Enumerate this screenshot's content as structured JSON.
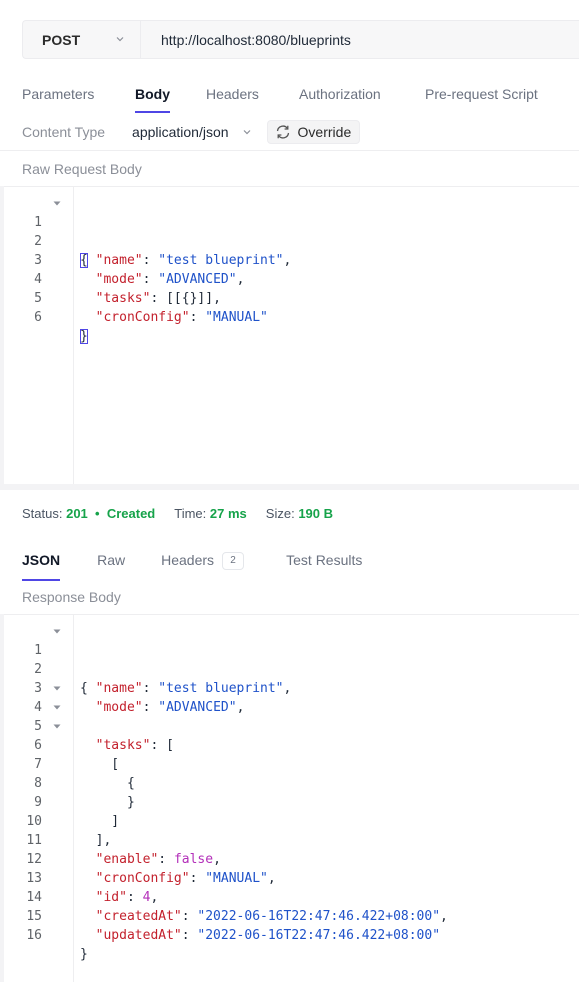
{
  "request": {
    "method": "POST",
    "url": "http://localhost:8080/blueprints"
  },
  "request_tabs": [
    "Parameters",
    "Body",
    "Headers",
    "Authorization",
    "Pre-request Script"
  ],
  "content_type": {
    "label": "Content Type",
    "value": "application/json",
    "override_label": "Override"
  },
  "raw_body_title": "Raw Request Body",
  "request_body": {
    "line_numbers": [
      "1",
      "2",
      "3",
      "4",
      "5",
      "6"
    ],
    "lines": [
      "{",
      "  \"name\": \"test blueprint\",",
      "  \"mode\": \"ADVANCED\",",
      "  \"tasks\": [[{}]],",
      "  \"cronConfig\": \"MANUAL\"",
      "}"
    ]
  },
  "status": {
    "status_label": "Status:",
    "code": "201",
    "bullet": "•",
    "text": "Created",
    "time_label": "Time:",
    "time": "27 ms",
    "size_label": "Size:",
    "size": "190 B"
  },
  "response_tabs": {
    "json": "JSON",
    "raw": "Raw",
    "headers": "Headers",
    "headers_count": "2",
    "test_results": "Test Results"
  },
  "response_body_title": "Response Body",
  "response_body": {
    "line_numbers": [
      "1",
      "2",
      "3",
      "4",
      "5",
      "6",
      "7",
      "8",
      "9",
      "10",
      "11",
      "12",
      "13",
      "14",
      "15",
      "16"
    ],
    "lines": [
      "{",
      "  \"name\": \"test blueprint\",",
      "  \"mode\": \"ADVANCED\",",
      "  \"tasks\": [",
      "    [",
      "      {",
      "",
      "      }",
      "    ]",
      "  ],",
      "  \"enable\": false,",
      "  \"cronConfig\": \"MANUAL\",",
      "  \"id\": 4,",
      "  \"createdAt\": \"2022-06-16T22:47:46.422+08:00\",",
      "  \"updatedAt\": \"2022-06-16T22:47:46.422+08:00\"",
      "}"
    ]
  },
  "colors": {
    "accent": "#4f46e5",
    "key": "#c3212d",
    "string": "#1f52c9",
    "boolean": "#b32fb9",
    "status_ok": "#16a34a"
  }
}
